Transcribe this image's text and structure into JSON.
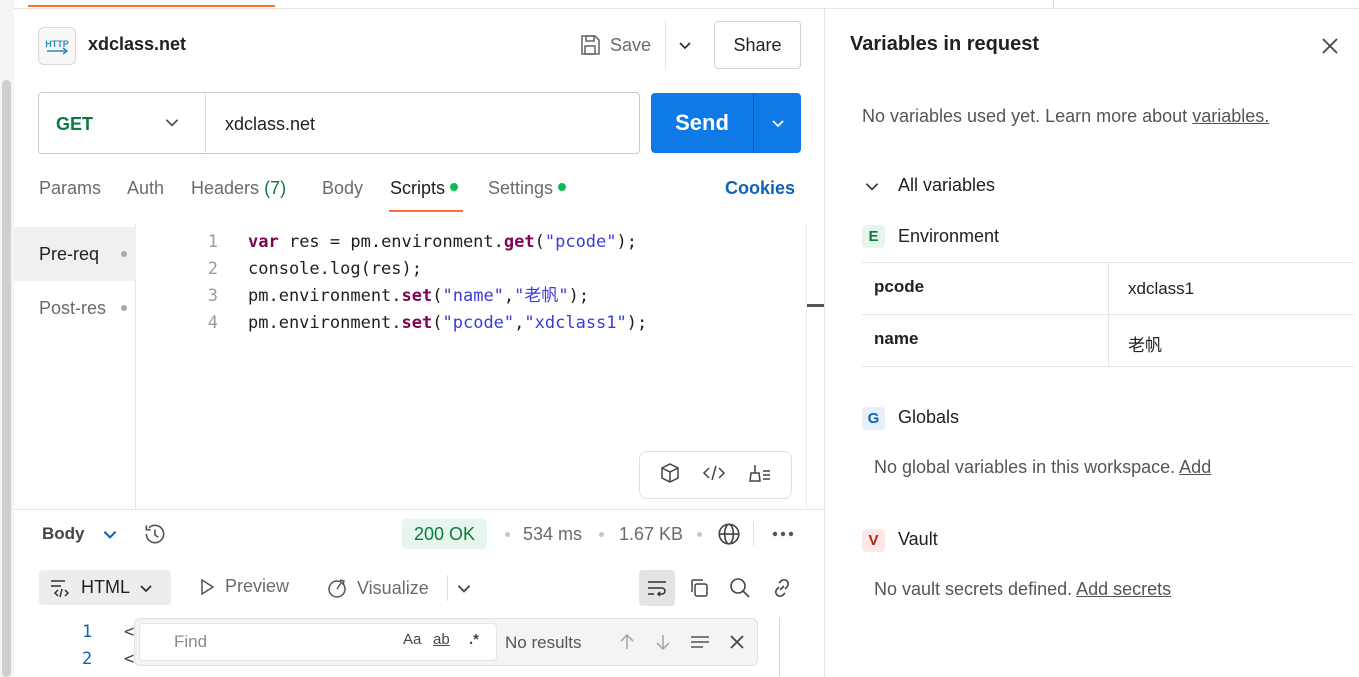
{
  "request": {
    "title": "xdclass.net",
    "icon_label": "HTTP",
    "save_label": "Save",
    "share_label": "Share",
    "method": "GET",
    "url": "xdclass.net",
    "send_label": "Send"
  },
  "tabs": {
    "params": "Params",
    "auth": "Auth",
    "headers": "Headers",
    "headers_count": "(7)",
    "body": "Body",
    "scripts": "Scripts",
    "settings": "Settings",
    "cookies": "Cookies"
  },
  "scripts": {
    "pre": "Pre-req",
    "post": "Post-res",
    "lines": [
      "1",
      "2",
      "3",
      "4"
    ]
  },
  "response": {
    "body_label": "Body",
    "status": "200 OK",
    "time": "534 ms",
    "size": "1.67 KB",
    "format": "HTML",
    "preview": "Preview",
    "visualize": "Visualize",
    "lines": [
      "1",
      "2"
    ],
    "line_prefix": "<",
    "find_placeholder": "Find",
    "find_case": "Aa",
    "find_word": "ab",
    "find_regex": ".*",
    "find_status": "No results"
  },
  "variables_panel": {
    "title": "Variables in request",
    "intro": "No variables used yet. Learn more about",
    "intro_link": "variables.",
    "all_variables": "All variables",
    "environment": {
      "badge": "E",
      "label": "Environment",
      "rows": [
        {
          "key": "pcode",
          "value": "xdclass1"
        },
        {
          "key": "name",
          "value": "老帆"
        }
      ]
    },
    "globals": {
      "badge": "G",
      "label": "Globals",
      "text": "No global variables in this workspace.",
      "link": "Add"
    },
    "vault": {
      "badge": "V",
      "label": "Vault",
      "text": "No vault secrets defined.",
      "link": "Add secrets"
    }
  },
  "colors": {
    "accent": "#ff6c37",
    "send": "#0f7ae5",
    "method_get": "#0a7a3e",
    "status_ok": "#0a7a3e"
  }
}
